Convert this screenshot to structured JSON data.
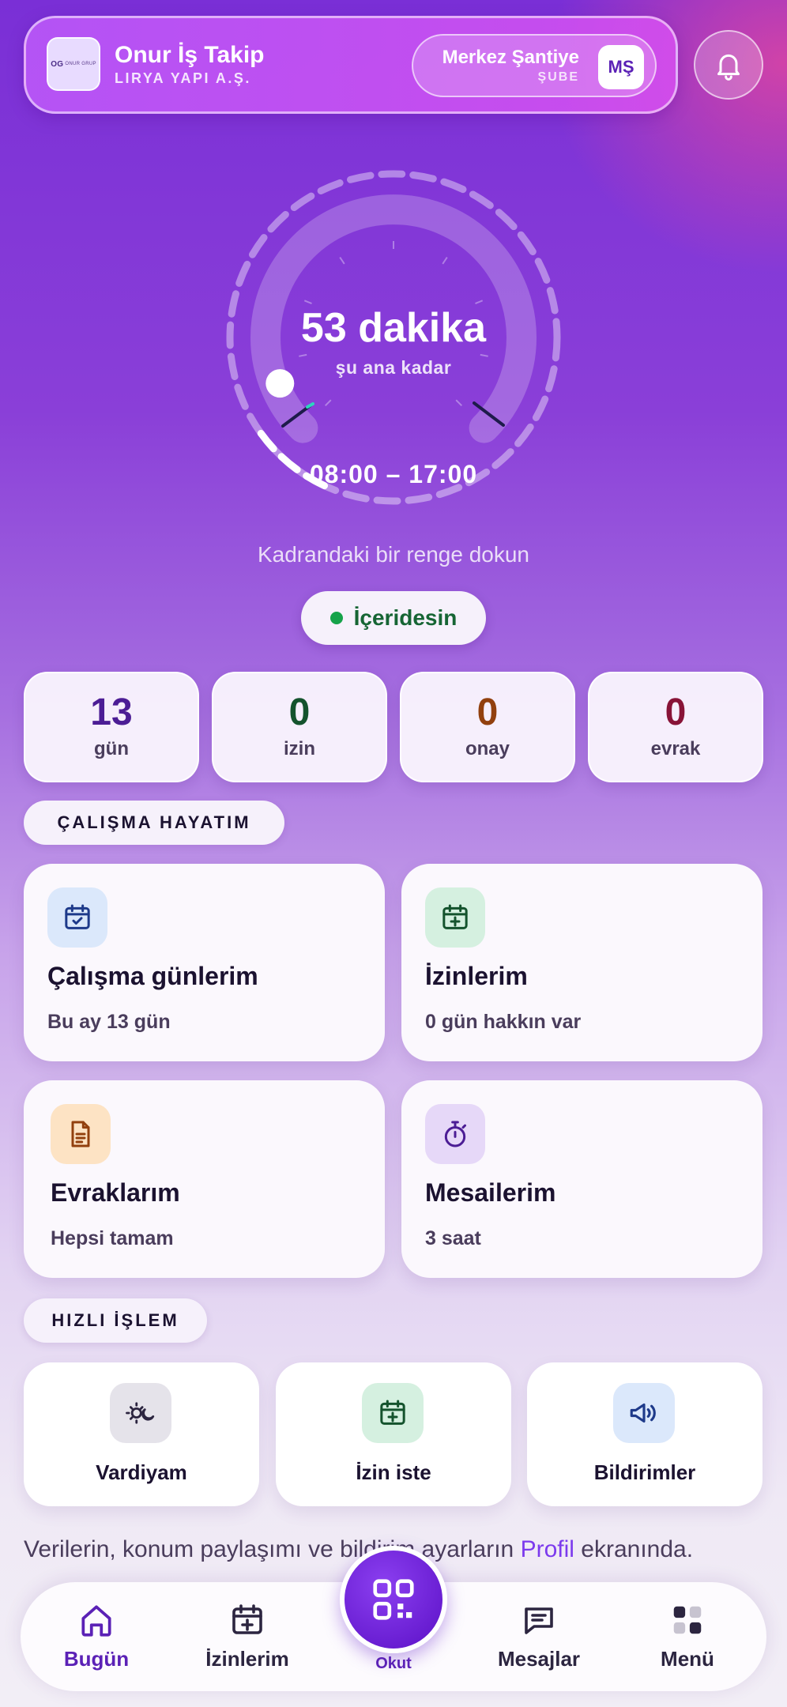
{
  "header": {
    "logo_text": "ONUR GRUP",
    "app_title": "Onur İş Takip",
    "company": "LIRYA YAPI A.Ş.",
    "branch_name": "Merkez Şantiye",
    "branch_type": "ŞUBE",
    "branch_badge": "MŞ",
    "icons": {
      "notifications": "bell-icon"
    }
  },
  "dial": {
    "value": "53 dakika",
    "caption": "şu ana kadar",
    "range": "08:00 – 17:00",
    "progress_fraction": 0.098
  },
  "hint": "Kadrandaki bir renge dokun",
  "status": {
    "label": "İçeridesin",
    "color": "#16a34a"
  },
  "stats": [
    {
      "value": "13",
      "label": "gün",
      "color": "#4c1d95"
    },
    {
      "value": "0",
      "label": "izin",
      "color": "#14532d"
    },
    {
      "value": "0",
      "label": "onay",
      "color": "#92400e"
    },
    {
      "value": "0",
      "label": "evrak",
      "color": "#881337"
    }
  ],
  "work_section": {
    "title": "ÇALIŞMA HAYATIM",
    "cards": [
      {
        "title": "Çalışma günlerim",
        "subtitle": "Bu ay 13 gün",
        "icon": "calendar-check-icon"
      },
      {
        "title": "İzinlerim",
        "subtitle": "0 gün hakkın var",
        "icon": "calendar-plus-icon"
      },
      {
        "title": "Evraklarım",
        "subtitle": "Hepsi tamam",
        "icon": "document-icon"
      },
      {
        "title": "Mesailerim",
        "subtitle": "3 saat",
        "icon": "stopwatch-icon"
      }
    ]
  },
  "quick_section": {
    "title": "HIZLI İŞLEM",
    "actions": [
      {
        "label": "Vardiyam",
        "icon": "sun-moon-icon"
      },
      {
        "label": "İzin iste",
        "icon": "calendar-plus-icon"
      },
      {
        "label": "Bildirimler",
        "icon": "megaphone-icon"
      }
    ]
  },
  "footer_note": {
    "before": "Verilerin, konum paylaşımı ve bildirim ayarların ",
    "link": "Profil",
    "after": " ekranında."
  },
  "nav": {
    "items": [
      {
        "label": "Bugün",
        "icon": "home-icon"
      },
      {
        "label": "İzinlerim",
        "icon": "calendar-plus-icon"
      },
      {
        "label": "Okut",
        "icon": "qr-scan-icon"
      },
      {
        "label": "Mesajlar",
        "icon": "message-icon"
      },
      {
        "label": "Menü",
        "icon": "grid-menu-icon"
      }
    ]
  },
  "colors": {
    "accent": "#5b21b6",
    "accent_light": "#7c3aed",
    "background_top": "#7a2fd6",
    "background_bottom": "#f2eef6"
  }
}
